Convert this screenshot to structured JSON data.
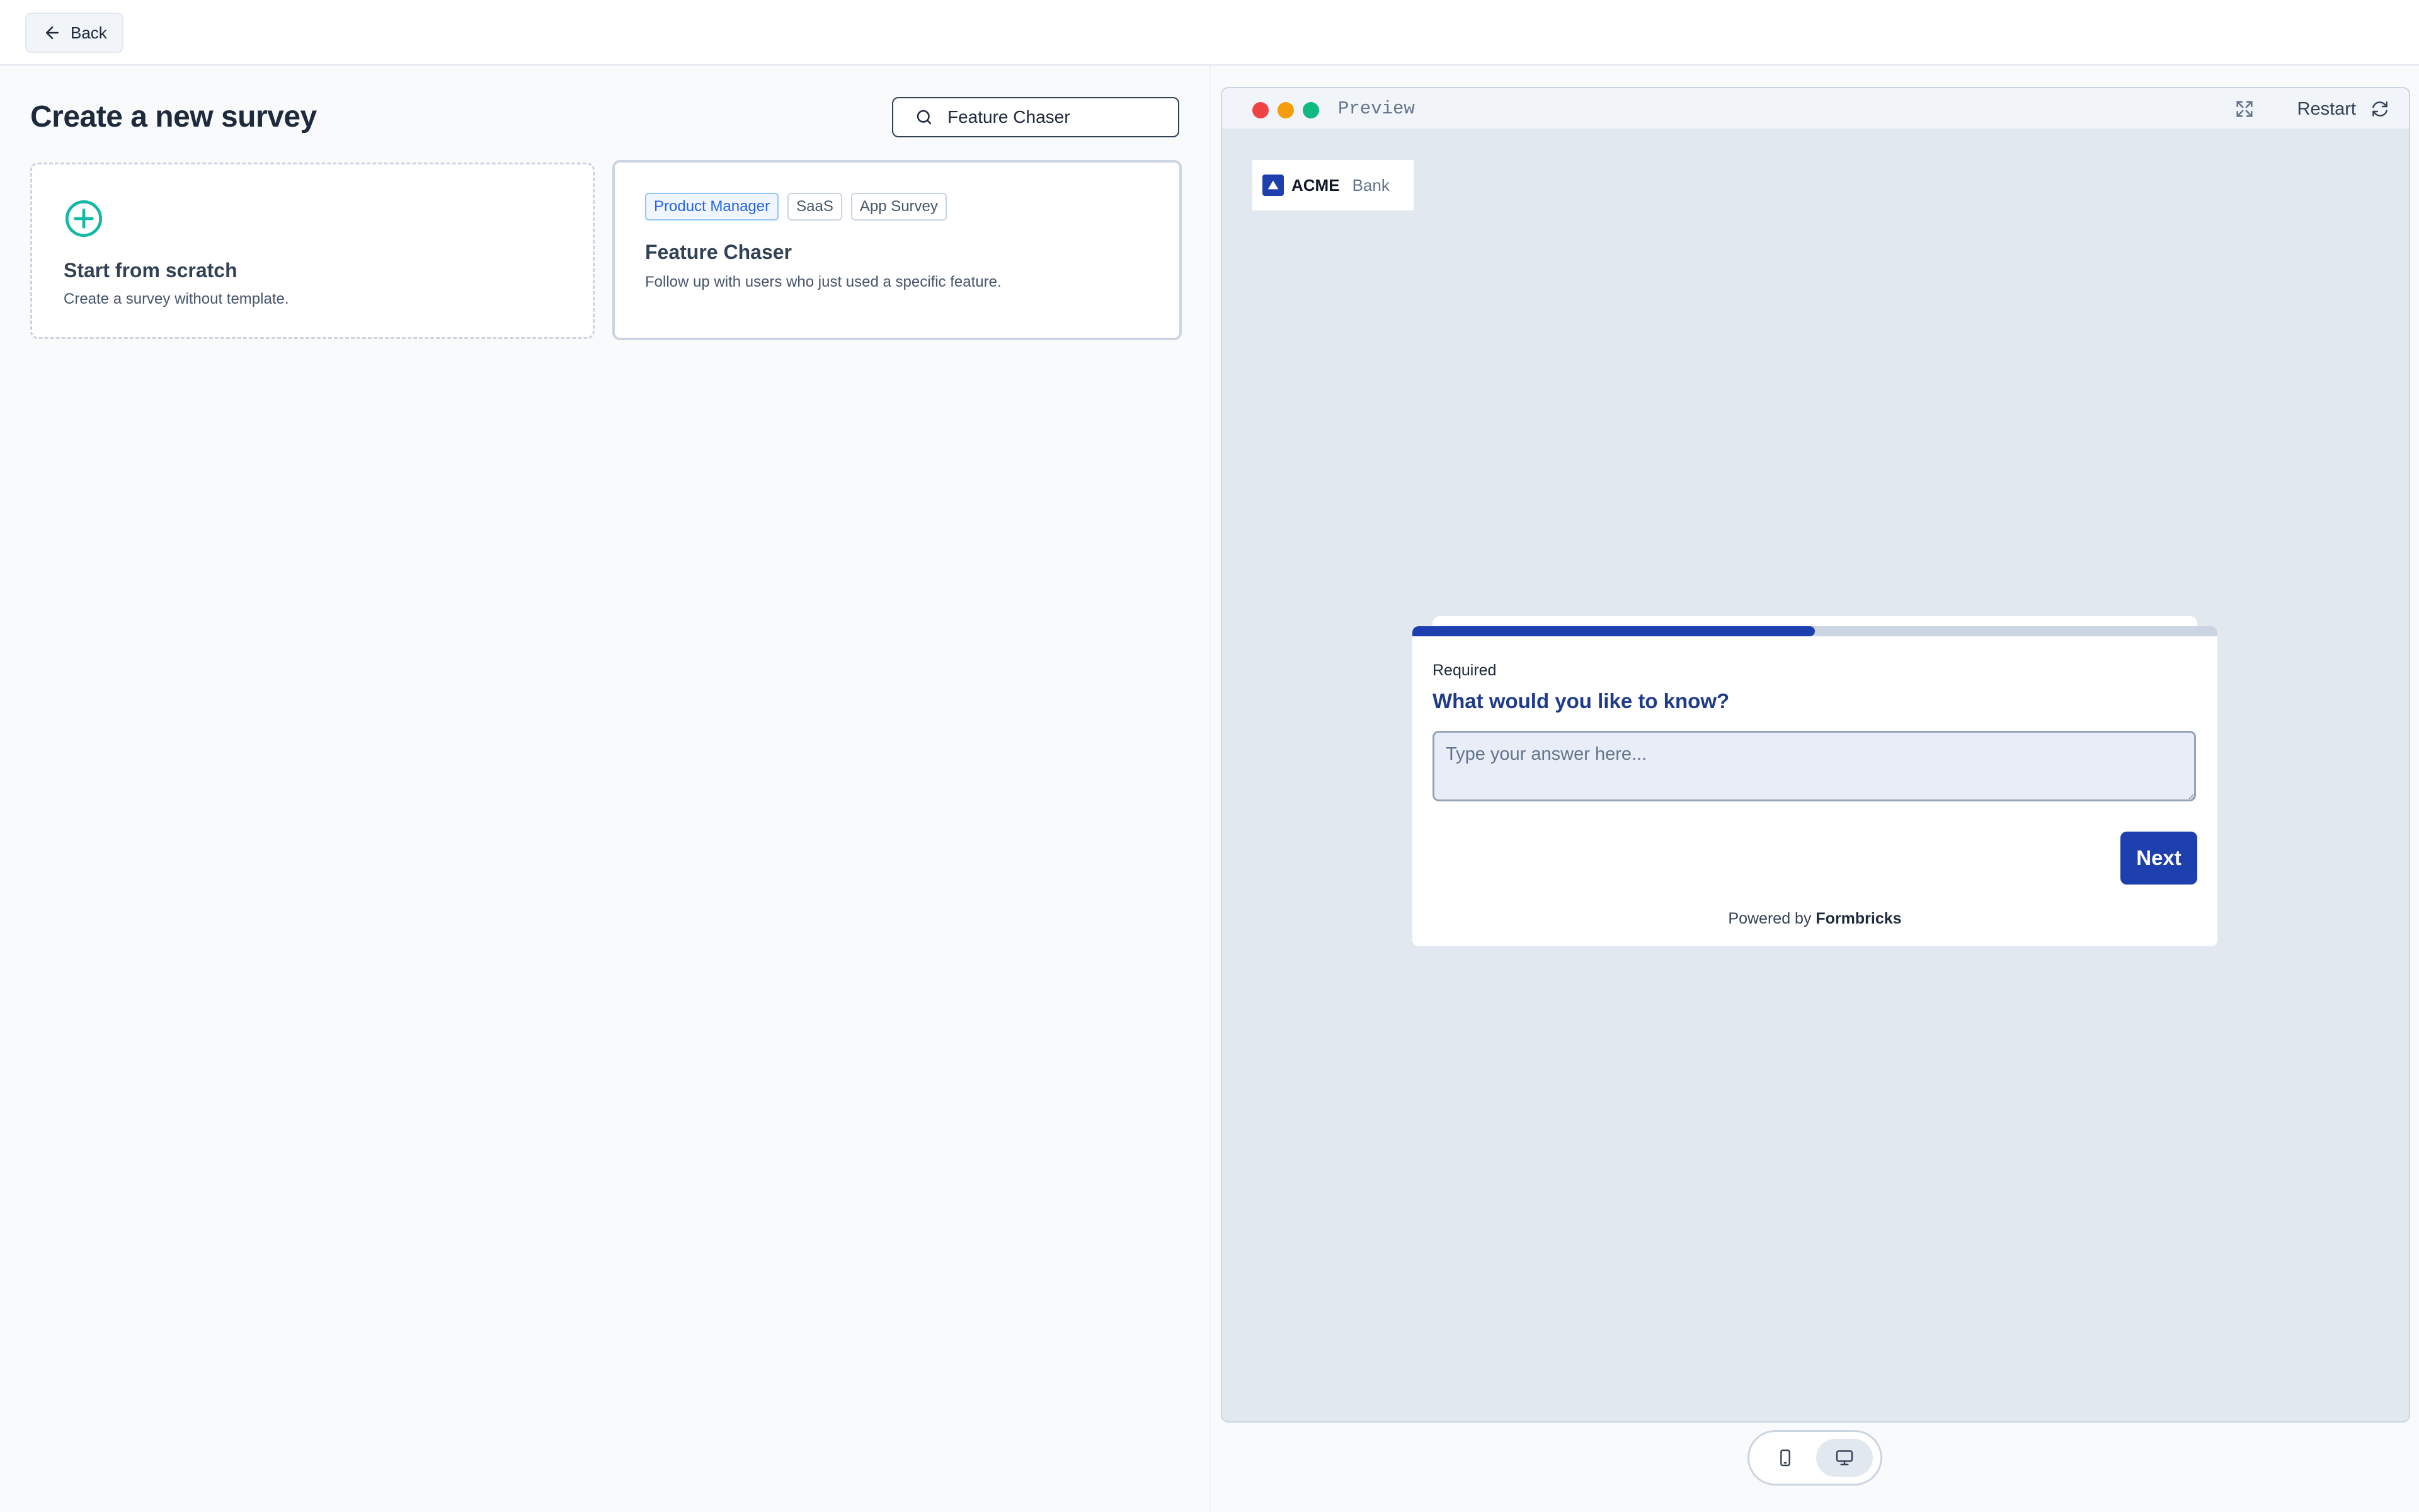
{
  "topbar": {
    "back_label": "Back"
  },
  "left": {
    "page_title": "Create a new survey",
    "search": {
      "value": "Feature Chaser",
      "placeholder": ""
    },
    "scratch_card": {
      "title": "Start from scratch",
      "description": "Create a survey without template."
    },
    "template_card": {
      "tags": [
        "Product Manager",
        "SaaS",
        "App Survey"
      ],
      "title": "Feature Chaser",
      "description": "Follow up with users who just used a specific feature."
    }
  },
  "preview": {
    "label": "Preview",
    "restart_label": "Restart",
    "logo": {
      "name": "ACME",
      "sub": "Bank"
    },
    "survey": {
      "progress_percent": 50,
      "required_label": "Required",
      "question": "What would you like to know?",
      "answer_placeholder": "Type your answer here...",
      "next_label": "Next",
      "powered_by_prefix": "Powered by",
      "powered_by_brand": "Formbricks"
    },
    "device_toggle": {
      "active": "desktop"
    }
  },
  "colors": {
    "brand": "#1e40af",
    "accent_teal": "#14b8a6",
    "tag_blue": "#2563eb"
  },
  "icons": {
    "back": "arrow-left-icon",
    "search": "search-icon",
    "scratch": "plus-circle-icon",
    "expand": "expand-icon",
    "restart": "refresh-icon",
    "mobile": "mobile-icon",
    "desktop": "desktop-icon"
  }
}
